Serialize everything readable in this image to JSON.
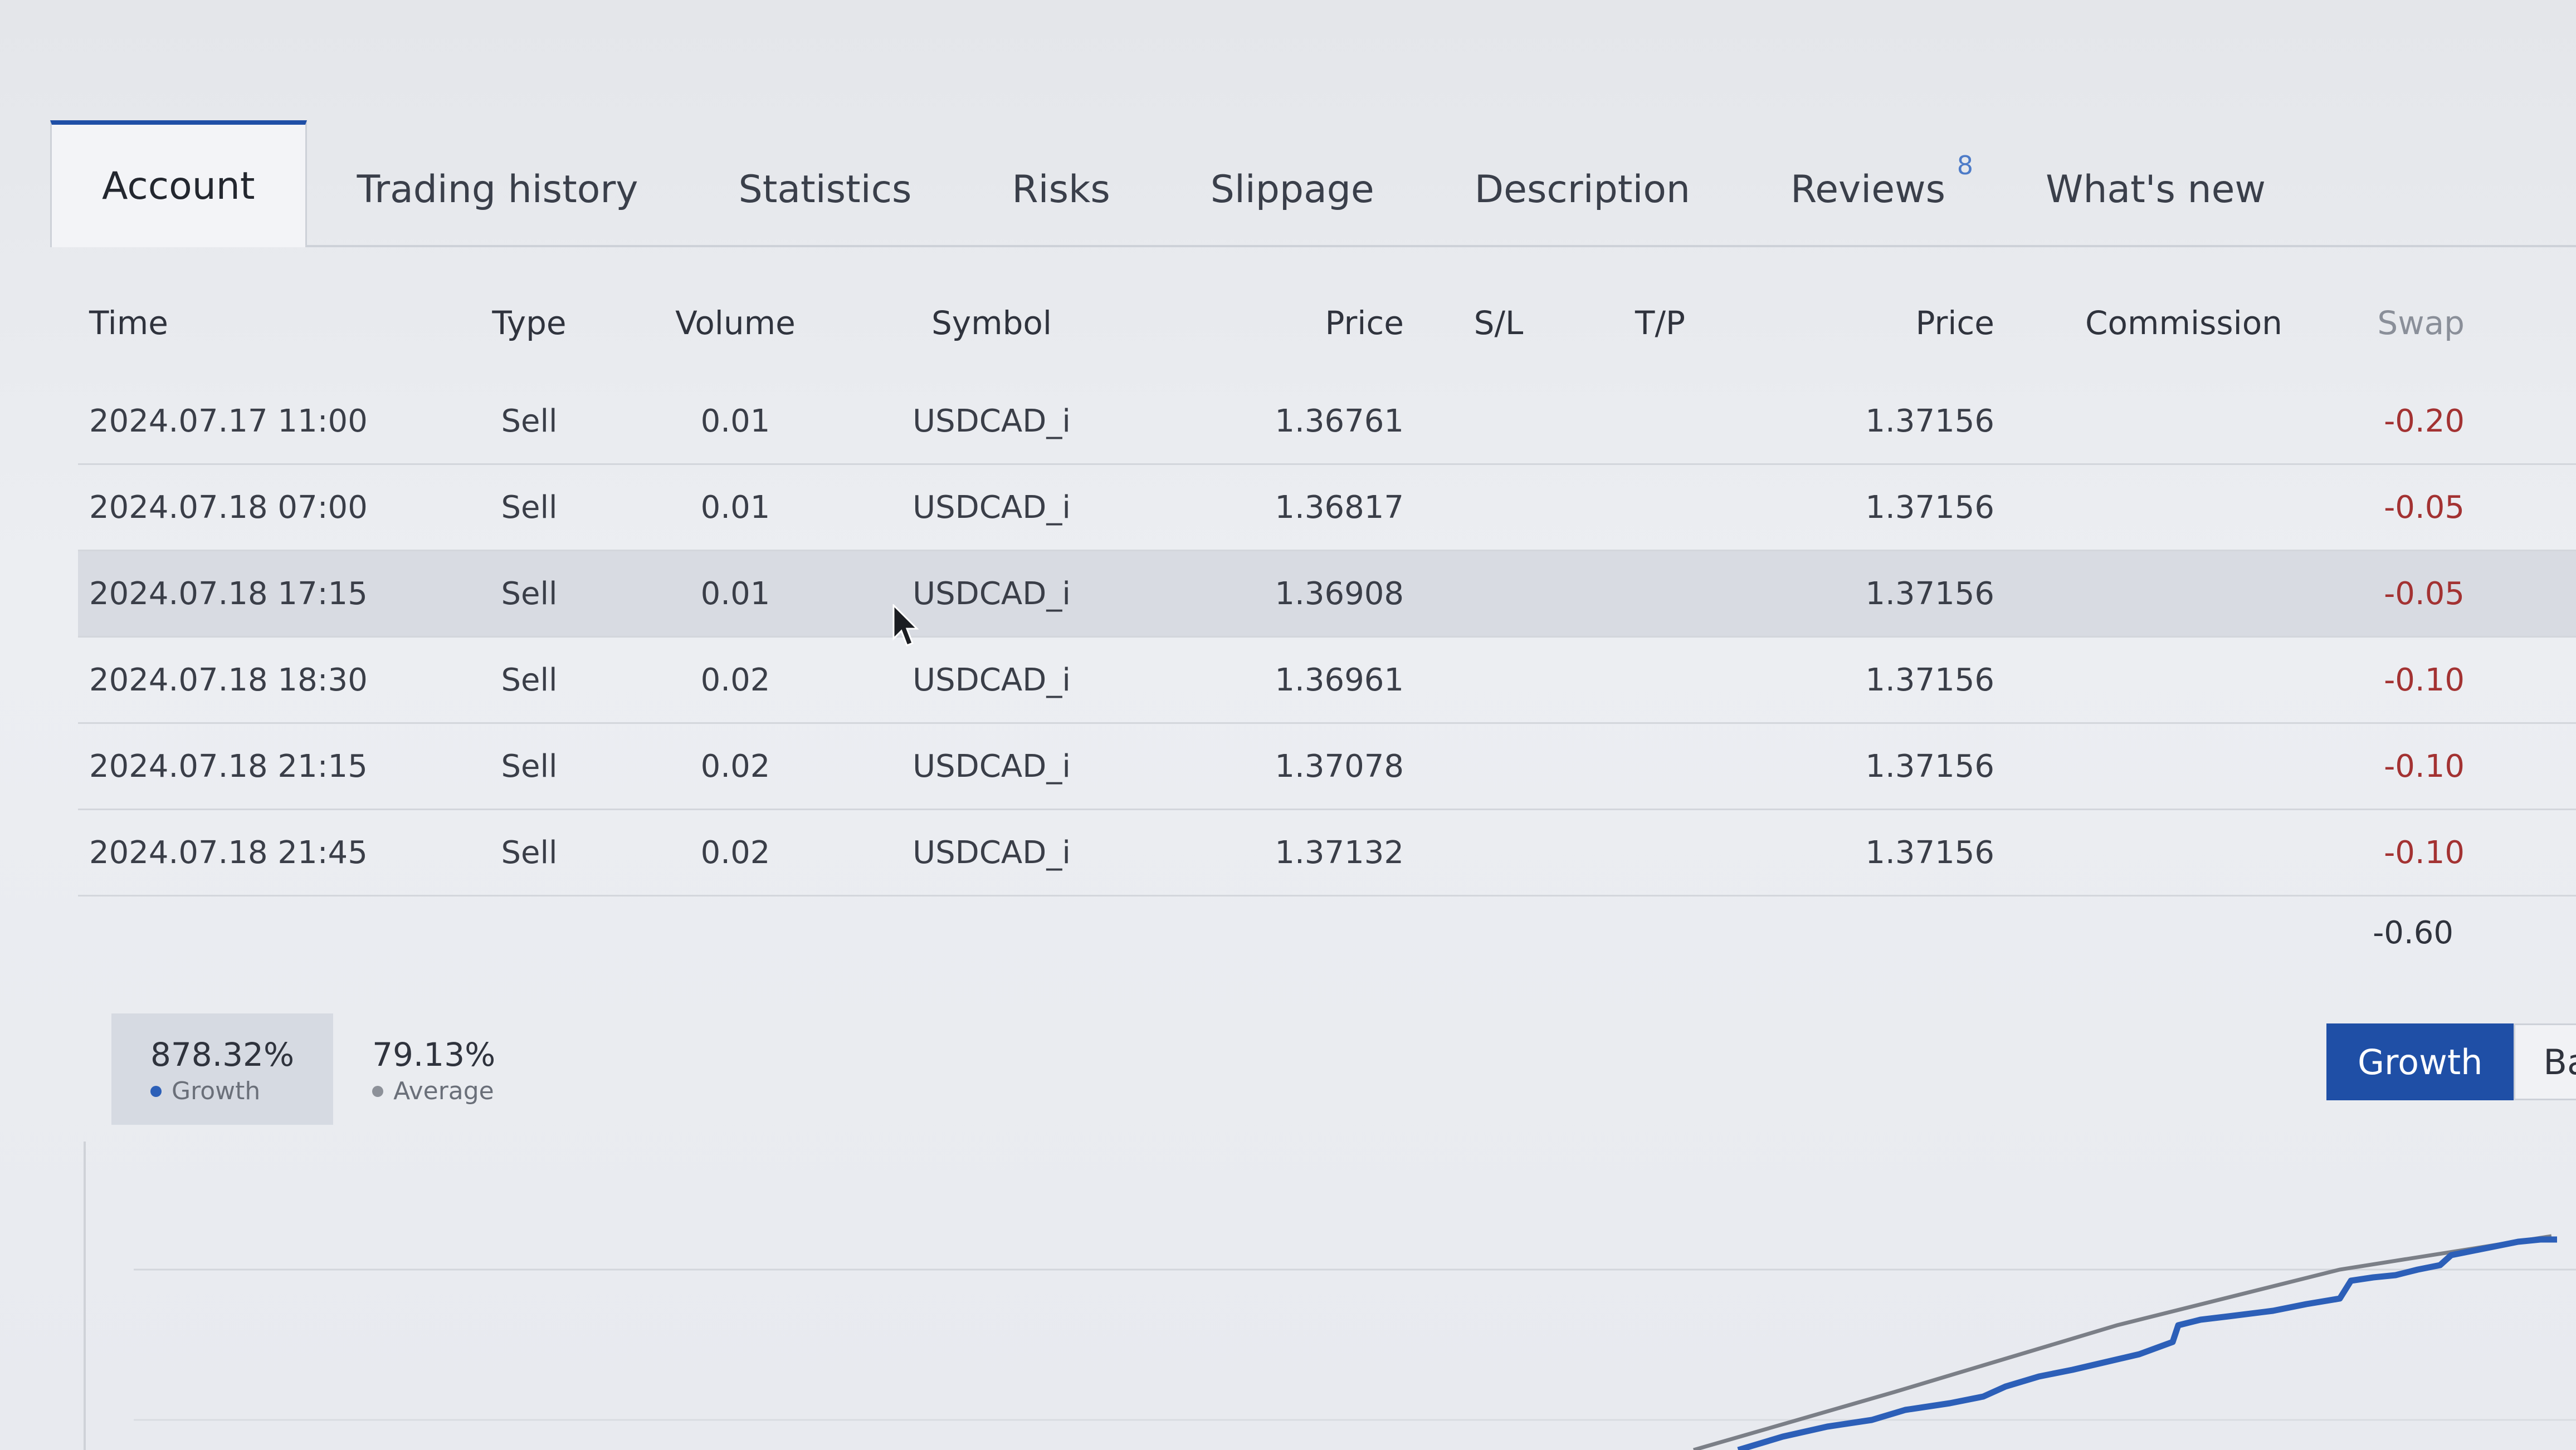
{
  "tabs": [
    {
      "label": "Account",
      "active": true
    },
    {
      "label": "Trading history"
    },
    {
      "label": "Statistics"
    },
    {
      "label": "Risks"
    },
    {
      "label": "Slippage"
    },
    {
      "label": "Description"
    },
    {
      "label": "Reviews",
      "badge": "8"
    },
    {
      "label": "What's new"
    }
  ],
  "table": {
    "headers": {
      "time": "Time",
      "type": "Type",
      "volume": "Volume",
      "symbol": "Symbol",
      "price": "Price",
      "sl": "S/L",
      "tp": "T/P",
      "price2": "Price",
      "commission": "Commission",
      "swap": "Swap"
    },
    "rows": [
      {
        "time": "2024.07.17 11:00",
        "type": "Sell",
        "volume": "0.01",
        "symbol": "USDCAD_i",
        "price": "1.36761",
        "sl": "",
        "tp": "",
        "price2": "1.37156",
        "commission": "",
        "swap": "-0.20"
      },
      {
        "time": "2024.07.18 07:00",
        "type": "Sell",
        "volume": "0.01",
        "symbol": "USDCAD_i",
        "price": "1.36817",
        "sl": "",
        "tp": "",
        "price2": "1.37156",
        "commission": "",
        "swap": "-0.05"
      },
      {
        "time": "2024.07.18 17:15",
        "type": "Sell",
        "volume": "0.01",
        "symbol": "USDCAD_i",
        "price": "1.36908",
        "sl": "",
        "tp": "",
        "price2": "1.37156",
        "commission": "",
        "swap": "-0.05"
      },
      {
        "time": "2024.07.18 18:30",
        "type": "Sell",
        "volume": "0.02",
        "symbol": "USDCAD_i",
        "price": "1.36961",
        "sl": "",
        "tp": "",
        "price2": "1.37156",
        "commission": "",
        "swap": "-0.10"
      },
      {
        "time": "2024.07.18 21:15",
        "type": "Sell",
        "volume": "0.02",
        "symbol": "USDCAD_i",
        "price": "1.37078",
        "sl": "",
        "tp": "",
        "price2": "1.37156",
        "commission": "",
        "swap": "-0.10"
      },
      {
        "time": "2024.07.18 21:45",
        "type": "Sell",
        "volume": "0.02",
        "symbol": "USDCAD_i",
        "price": "1.37132",
        "sl": "",
        "tp": "",
        "price2": "1.37156",
        "commission": "",
        "swap": "-0.10"
      }
    ],
    "total_swap": "-0.60"
  },
  "stats": [
    {
      "value": "878.32%",
      "label": "Growth",
      "active": true
    },
    {
      "value": "79.13%",
      "label": "Average"
    }
  ],
  "chart_buttons": {
    "growth": "Growth",
    "balance": "Ba"
  },
  "colors": {
    "accent": "#1f4fa6",
    "negative": "#a33232",
    "growth_line": "#2c5fb8",
    "average_line": "#8d9199"
  },
  "icons": {
    "cursor": "arrow-cursor-icon"
  }
}
